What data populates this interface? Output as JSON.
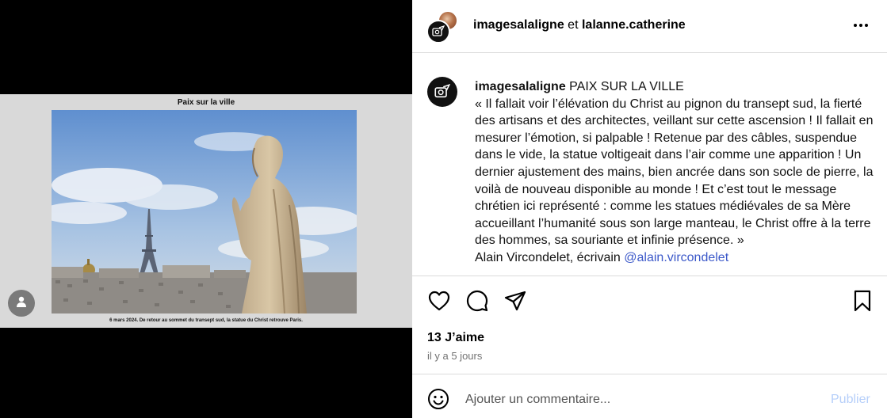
{
  "media": {
    "slide_title": "Paix sur la ville",
    "slide_caption": "6 mars 2024. De retour au sommet du transept sud, la statue du Christ retrouve Paris.",
    "tag_icon": "person-icon"
  },
  "header": {
    "user1": "imagesalaligne",
    "connector": "et",
    "user2": "lalanne.catherine",
    "more_icon": "more-horizontal-icon"
  },
  "caption": {
    "username": "imagesalaligne",
    "title": "PAIX SUR LA VILLE",
    "body": "« Il fallait voir l’élévation du Christ au pignon du transept sud, la fierté des artisans et des architectes, veillant sur cette ascension ! Il fallait en mesurer l’émotion, si palpable ! Retenue par des câbles, suspendue dans le vide, la statue voltigeait dans l’air comme une apparition ! Un dernier ajustement des mains, bien ancrée dans son socle de pierre, la voilà de nouveau disponible au monde ! Et c’est tout le message chrétien ici représenté : comme les statues médiévales de sa Mère accueillant l’humanité sous son large manteau, le Christ offre à la terre des hommes, sa souriante et infinie présence. »",
    "author_line": "Alain Vircondelet, écrivain",
    "mention": "@alain.vircondelet"
  },
  "actions": {
    "likes": "13 J’aime",
    "time": "il y a 5 jours",
    "icons": [
      "heart-icon",
      "comment-icon",
      "share-icon",
      "bookmark-icon"
    ]
  },
  "comment": {
    "placeholder": "Ajouter un commentaire...",
    "publish": "Publier",
    "emoji_icon": "smiley-icon"
  },
  "colors": {
    "link": "#3b58c9",
    "publish_disabled": "#b6cffa",
    "border": "#dbdbdb",
    "secondary_text": "#737373"
  }
}
